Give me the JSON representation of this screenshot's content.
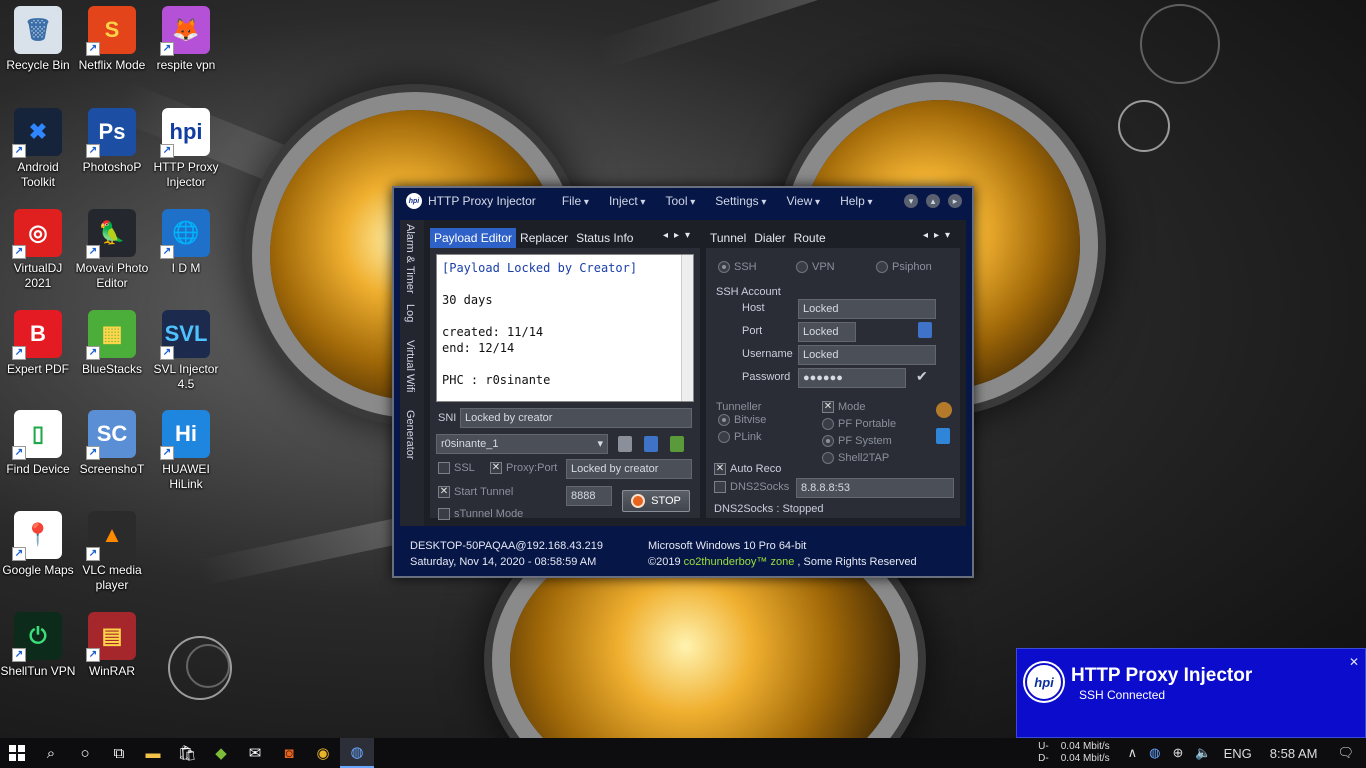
{
  "desktop": {
    "icons": [
      {
        "label": "Recycle Bin",
        "glyph": "🗑",
        "bg": "#d9e2ea",
        "fg": "#3a6ea8"
      },
      {
        "label": "Netflix Mode",
        "glyph": "S",
        "bg": "#e3441a",
        "fg": "#ffd24a"
      },
      {
        "label": "respite vpn",
        "glyph": "🦊",
        "bg": "#b451d6",
        "fg": "#ffffff"
      },
      {
        "label": "Android Toolkit",
        "glyph": "✖",
        "bg": "#15233b",
        "fg": "#2f86ff"
      },
      {
        "label": "PhotoshoP",
        "glyph": "Ps",
        "bg": "#1c4fa4",
        "fg": "#ffffff"
      },
      {
        "label": "HTTP Proxy Injector",
        "glyph": "hpi",
        "bg": "#ffffff",
        "fg": "#123c9f"
      },
      {
        "label": "VirtualDJ 2021",
        "glyph": "◎",
        "bg": "#e0201e",
        "fg": "#ffffff"
      },
      {
        "label": "Movavi Photo Editor",
        "glyph": "🦜",
        "bg": "#25272e",
        "fg": "#ffffff"
      },
      {
        "label": "I D M",
        "glyph": "🌐",
        "bg": "#1e70c9",
        "fg": "#7cd14a"
      },
      {
        "label": "Expert PDF",
        "glyph": "B",
        "bg": "#e41b23",
        "fg": "#ffffff"
      },
      {
        "label": "BlueStacks",
        "glyph": "▦",
        "bg": "#4cae3a",
        "fg": "#ffd54a"
      },
      {
        "label": "SVL Injector 4.5",
        "glyph": "SVL",
        "bg": "#1b2a4d",
        "fg": "#4fc3ff"
      },
      {
        "label": "Find Device",
        "glyph": "▯",
        "bg": "#ffffff",
        "fg": "#1fa84a"
      },
      {
        "label": "ScreenshoT",
        "glyph": "SC",
        "bg": "#5a8fd6",
        "fg": "#ffffff"
      },
      {
        "label": "HUAWEI HiLink",
        "glyph": "Hi",
        "bg": "#1f86e0",
        "fg": "#ffffff"
      },
      {
        "label": "Google Maps",
        "glyph": "📍",
        "bg": "#ffffff",
        "fg": "#e0392c"
      },
      {
        "label": "VLC media player",
        "glyph": "▲",
        "bg": "#2b2b2b",
        "fg": "#ff8a00"
      },
      {
        "label": "ShellTun VPN",
        "glyph": "⏻",
        "bg": "#0c2b1a",
        "fg": "#3ce07a"
      },
      {
        "label": "WinRAR",
        "glyph": "▤",
        "bg": "#a5262b",
        "fg": "#ffd34a"
      }
    ]
  },
  "hpi": {
    "title": "HTTP Proxy Injector",
    "menu": [
      "File",
      "Inject",
      "Tool",
      "Settings",
      "View",
      "Help"
    ],
    "side_tabs": [
      "Alarm & Timer",
      "Log",
      "Virtual Wifi",
      "Generator"
    ],
    "left_tabs": [
      "Payload Editor",
      "Replacer",
      "Status Info"
    ],
    "right_tabs": [
      "Tunnel",
      "Dialer",
      "Route"
    ],
    "payload_lines": [
      "[Payload Locked by Creator]",
      "",
      "30 days",
      "",
      "created: 11/14",
      "end: 12/14",
      "",
      "PHC : r0sinante"
    ],
    "sni_label": "SNI",
    "sni_value": "Locked by creator",
    "profile_value": "r0sinante_1",
    "ssl_label": "SSL",
    "proxy_port_label": "Proxy:Port",
    "proxy_value": "Locked by creator",
    "start_tunnel_label": "Start Tunnel",
    "port_value": "8888",
    "stop_label": "STOP",
    "stunnel_label": "sTunnel Mode",
    "tunnel_types": [
      "SSH",
      "VPN",
      "Psiphon"
    ],
    "ssh_account_label": "SSH Account",
    "host_label": "Host",
    "host_value": "Locked",
    "port_label": "Port",
    "port_field_value": "Locked",
    "username_label": "Username",
    "username_value": "Locked",
    "password_label": "Password",
    "password_value": "●●●●●●",
    "tunneller_label": "Tunneller",
    "tunneller_options": [
      "Bitvise",
      "PLink"
    ],
    "mode_label": "Mode",
    "mode_options": [
      "PF Portable",
      "PF System",
      "Shell2TAP"
    ],
    "auto_reco_label": "Auto Reco",
    "dns2socks_label": "DNS2Socks",
    "dns_value": "8.8.8.8:53",
    "dns_status": "DNS2Socks : Stopped",
    "status_left_1": "DESKTOP-50PAQAA@192.168.43.219",
    "status_left_2": "Saturday, Nov 14, 2020 - 08:58:59 AM",
    "status_right_1": "Microsoft Windows 10 Pro 64-bit",
    "status_right_2_prefix": "©2019 ",
    "status_right_2_brand": "co2thunderboy™ zone",
    "status_right_2_suffix": " , Some Rights Reserved"
  },
  "toast": {
    "logo": "hpi",
    "title": "HTTP Proxy Injector",
    "subtitle": "SSH Connected",
    "close": "✕"
  },
  "taskbar": {
    "up_label": "U-",
    "down_label": "D-",
    "up_speed": "0.04 Mbit/s",
    "down_speed": "0.04 Mbit/s",
    "language": "ENG",
    "time": "8:58 AM"
  }
}
